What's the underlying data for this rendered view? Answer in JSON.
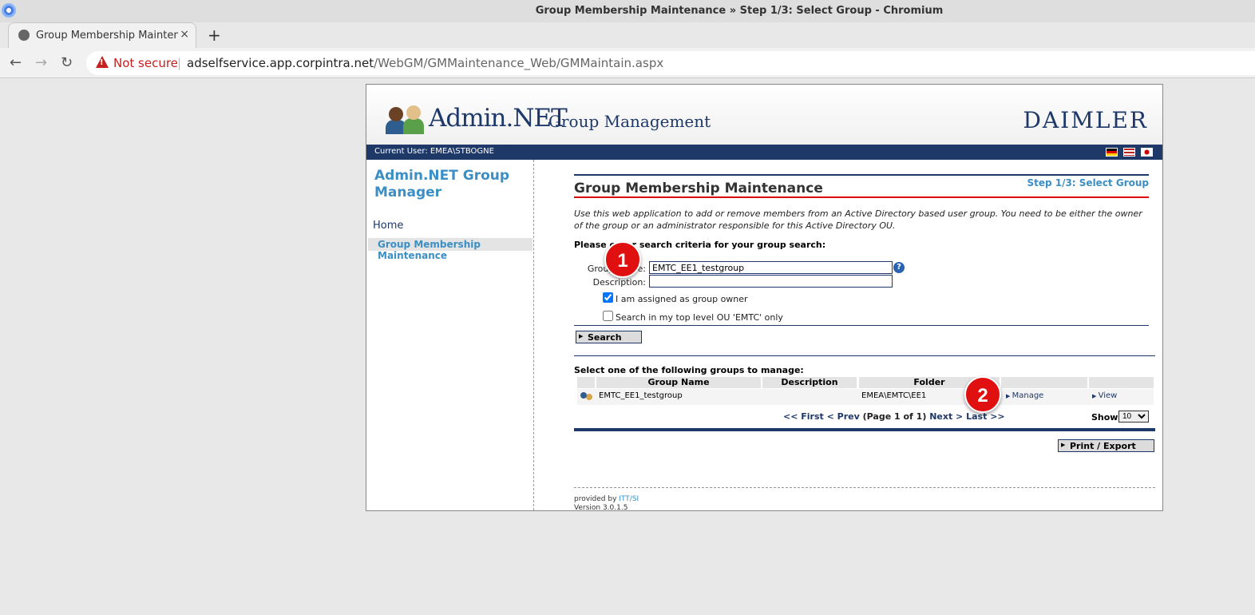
{
  "browser": {
    "window_title": "Group Membership Maintenance » Step 1/3: Select Group - Chromium",
    "tab_title": "Group Membership Maintenance",
    "tab_close": "×",
    "new_tab": "+",
    "not_secure": "Not secure",
    "separator": "|",
    "url_host": "adselfservice.app.corpintra.net",
    "url_path": "/WebGM/GMMaintenance_Web/GMMaintain.aspx",
    "back": "←",
    "forward": "→",
    "reload": "↻"
  },
  "header": {
    "brand": "Admin.NET",
    "brand_sub": "Group Management",
    "company": "DAIMLER",
    "current_user": "Current User: EMEA\\STBOGNE"
  },
  "sidebar": {
    "title": "Admin.NET Group Manager",
    "items": [
      {
        "label": "Home"
      },
      {
        "label": "Group Membership Maintenance"
      }
    ]
  },
  "main": {
    "step": "Step 1/3: Select Group",
    "title": "Group Membership Maintenance",
    "intro": "Use this web application to add or remove members from an Active Directory based user group. You need to be either the owner of the group or an administrator responsible for this Active Directory OU.",
    "criteria_label": "Please enter search criteria for your group search:",
    "group_name_label": "Group Name:",
    "group_name_value": "EMTC_EE1_testgroup",
    "description_label": "Description:",
    "description_value": "",
    "help": "?",
    "owner_checkbox_label": "I am assigned as group owner",
    "owner_checked": true,
    "toplevel_checkbox_label": "Search in my top level OU 'EMTC' only",
    "toplevel_checked": false,
    "search_button": "Search",
    "select_title": "Select one of the following groups to manage:",
    "columns": [
      "Group Name",
      "Description",
      "Folder"
    ],
    "rows": [
      {
        "group_name": "EMTC_EE1_testgroup",
        "description": "",
        "folder": "EMEA\\EMTC\\EE1",
        "manage": "Manage",
        "view": "View"
      }
    ],
    "pager": {
      "first": "<< First",
      "prev": "< Prev",
      "info": "(Page 1 of 1)",
      "next": "Next >",
      "last": "Last >>"
    },
    "show_label": "Show",
    "show_value": "10",
    "print_button": "Print / Export",
    "footer_provided": "provided by",
    "footer_itt": "ITT/SI",
    "footer_version": "Version 3.0.1.5"
  },
  "annotations": [
    "1",
    "2"
  ],
  "colors": {
    "accent": "#1e3868",
    "link": "#3b8fc4",
    "badge": "#e01010",
    "rule": "#d00000"
  }
}
